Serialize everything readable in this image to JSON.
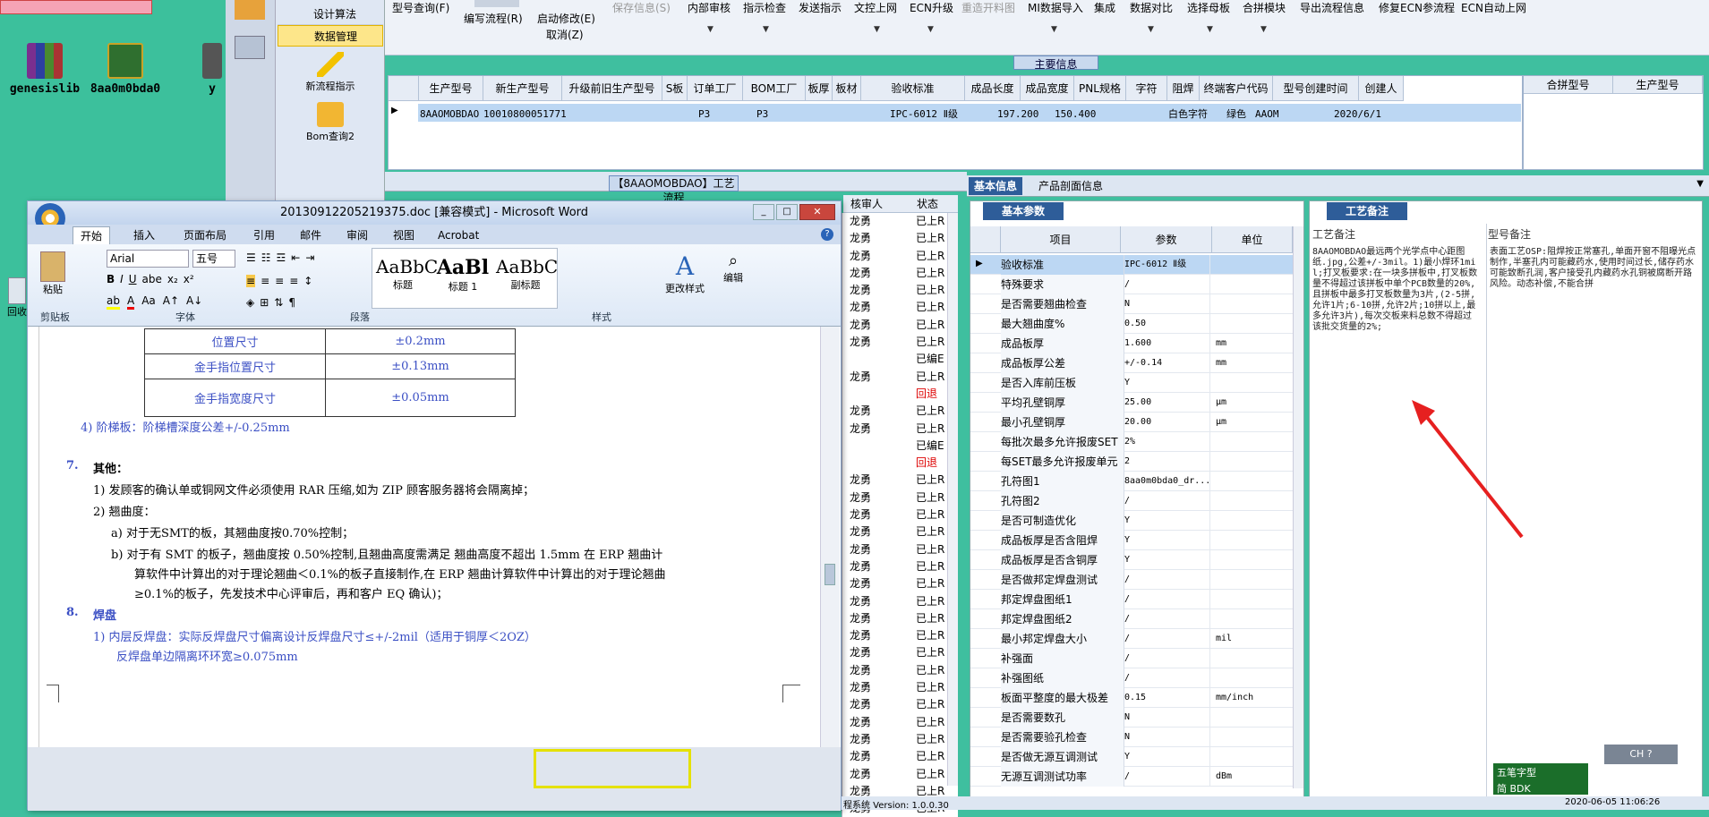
{
  "desktop": {
    "icons": [
      {
        "label": "genesislib"
      },
      {
        "label": "8aa0m0bda0"
      },
      {
        "label": "y"
      }
    ],
    "recycle": "回收"
  },
  "leftpanel": {
    "items": [
      "设计算法",
      "数据管理"
    ],
    "big": [
      "新流程指示",
      "Bom查询2"
    ]
  },
  "toolbar": {
    "buttons": [
      "型号查询(F)",
      "编写流程(R)",
      "启动修改(E)",
      "保存信息(S)",
      "内部审核",
      "指示检查",
      "发送指示",
      "文控上网",
      "ECN升级",
      "重造开料图",
      "MI数据导入",
      "集成",
      "数据对比",
      "选择母板",
      "合拼模块",
      "导出流程信息",
      "修复ECN参流程",
      "ECN自动上网"
    ],
    "cancel": "取消(Z)",
    "main_info": "主要信息"
  },
  "topgrid": {
    "headers": [
      "生产型号",
      "新生产型号",
      "升级前旧生产型号",
      "S板",
      "订单工厂",
      "BOM工厂",
      "板厚",
      "板材",
      "验收标准",
      "成品长度",
      "成品宽度",
      "PNL规格",
      "字符",
      "阻焊",
      "终端客户代码",
      "型号创建时间",
      "创建人"
    ],
    "row": [
      "8AAOMOBDAO",
      "10010800051771",
      "",
      "",
      "P3",
      "P3",
      "",
      "",
      "IPC-6012 Ⅱ级",
      "197.200",
      "150.400",
      "",
      "白色字符",
      "绿色",
      "AAOM",
      "2020/6/1",
      ""
    ],
    "right_headers": [
      "合拼型号",
      "生产型号"
    ]
  },
  "flow": {
    "title": "【8AAOMOBDAO】工艺流程",
    "review_header": "核审人",
    "status_header": "状态"
  },
  "review_rows": [
    [
      "龙勇",
      "已上R"
    ],
    [
      "龙勇",
      "已上R"
    ],
    [
      "龙勇",
      "已上R"
    ],
    [
      "龙勇",
      "已上R"
    ],
    [
      "龙勇",
      "已上R"
    ],
    [
      "龙勇",
      "已上R"
    ],
    [
      "龙勇",
      "已上R"
    ],
    [
      "龙勇",
      "已上R"
    ],
    [
      "",
      "已编E"
    ],
    [
      "龙勇",
      "已上R"
    ],
    [
      "",
      "回退"
    ],
    [
      "龙勇",
      "已上R"
    ],
    [
      "龙勇",
      "已上R"
    ],
    [
      "",
      "已编E"
    ],
    [
      "",
      "回退"
    ],
    [
      "龙勇",
      "已上R"
    ],
    [
      "龙勇",
      "已上R"
    ],
    [
      "龙勇",
      "已上R"
    ],
    [
      "龙勇",
      "已上R"
    ],
    [
      "龙勇",
      "已上R"
    ],
    [
      "龙勇",
      "已上R"
    ],
    [
      "龙勇",
      "已上R"
    ],
    [
      "龙勇",
      "已上R"
    ],
    [
      "龙勇",
      "已上R"
    ],
    [
      "龙勇",
      "已上R"
    ],
    [
      "龙勇",
      "已上R"
    ],
    [
      "龙勇",
      "已上R"
    ],
    [
      "龙勇",
      "已上R"
    ],
    [
      "龙勇",
      "已上R"
    ],
    [
      "龙勇",
      "已上R"
    ],
    [
      "龙勇",
      "已上R"
    ],
    [
      "龙勇",
      "已上R"
    ],
    [
      "龙勇",
      "已上R"
    ],
    [
      "龙勇",
      "已上R"
    ],
    [
      "龙勇",
      "已上R"
    ]
  ],
  "rightpanel": {
    "tabs": [
      "基本信息",
      "产品剖面信息"
    ],
    "basic_tab": "基本参数",
    "craft_tab": "工艺备注",
    "headers": [
      "项目",
      "参数",
      "单位"
    ],
    "rows": [
      [
        "验收标准",
        "IPC-6012 Ⅱ级",
        ""
      ],
      [
        "特殊要求",
        "/",
        ""
      ],
      [
        "是否需要翘曲检查",
        "N",
        ""
      ],
      [
        "最大翘曲度%",
        "0.50",
        ""
      ],
      [
        "成品板厚",
        "1.600",
        "mm"
      ],
      [
        "成品板厚公差",
        "+/-0.14",
        "mm"
      ],
      [
        "是否入库前压板",
        "Y",
        ""
      ],
      [
        "平均孔壁铜厚",
        "25.00",
        "μm"
      ],
      [
        "最小孔壁铜厚",
        "20.00",
        "μm"
      ],
      [
        "每批次最多允许报废SET",
        "2%",
        ""
      ],
      [
        "每SET最多允许报废单元",
        "2",
        ""
      ],
      [
        "孔符图1",
        "8aa0m0bda0_dr...",
        ""
      ],
      [
        "孔符图2",
        "/",
        ""
      ],
      [
        "是否可制造优化",
        "Y",
        ""
      ],
      [
        "成品板厚是否含阻焊",
        "Y",
        ""
      ],
      [
        "成品板厚是否含铜厚",
        "Y",
        ""
      ],
      [
        "是否做邦定焊盘测试",
        "/",
        ""
      ],
      [
        "邦定焊盘图纸1",
        "/",
        ""
      ],
      [
        "邦定焊盘图纸2",
        "/",
        ""
      ],
      [
        "最小邦定焊盘大小",
        "/",
        "mil"
      ],
      [
        "补强面",
        "/",
        ""
      ],
      [
        "补强图纸",
        "/",
        ""
      ],
      [
        "板面平整度的最大极差",
        "0.15",
        "mm/inch"
      ],
      [
        "是否需要数孔",
        "N",
        ""
      ],
      [
        "是否需要验孔检查",
        "N",
        ""
      ],
      [
        "是否做无源互调测试",
        "Y",
        ""
      ],
      [
        "无源互调测试功率",
        "/",
        "dBm"
      ]
    ],
    "craft_h1": "工艺备注",
    "craft_h2": "型号备注",
    "craft_text1": "8AAOMOBDAO最远两个光学点中心距图纸.jpg,公差+/-3mil。1)最小焊环1mil;打叉板要求:在一块多拼板中,打叉板数量不得超过该拼板中单个PCB数量的20%,且拼板中最多打叉板数量为3片,(2-5拼,允许1片;6-10拼,允许2片;10拼以上,最多允许3片),每次交板来料总数不得超过该批交货量的2%;",
    "craft_text2": "表面工艺OSP:阻焊按正常塞孔,单面开窗不阻曝光点制作,半塞孔内可能藏药水,使用时间过长,储存药水可能致断孔润,客户接受孔内藏药水孔铜被腐断开路风险。动态补偿,不能合拼"
  },
  "word": {
    "title": "20130912205219375.doc [兼容模式] - Microsoft Word",
    "tabs": [
      "开始",
      "插入",
      "页面布局",
      "引用",
      "邮件",
      "审阅",
      "视图",
      "Acrobat"
    ],
    "font": "Arial",
    "size": "五号",
    "groups": [
      "剪贴板",
      "字体",
      "段落",
      "样式",
      "编辑"
    ],
    "paste": "粘贴",
    "styles": [
      {
        "sample": "AaBbC",
        "name": "标题"
      },
      {
        "sample": "AaBl",
        "name": "标题 1"
      },
      {
        "sample": "AaBbC",
        "name": "副标题"
      }
    ],
    "change_style": "更改样式",
    "edit": "编辑",
    "table": [
      [
        "位置尺寸",
        "±0.2mm"
      ],
      [
        "金手指位置尺寸",
        "±0.13mm"
      ],
      [
        "金手指宽度尺寸",
        "±0.05mm"
      ]
    ],
    "lines": {
      "l4": "4) 阶梯板：阶梯槽深度公差+/-0.25mm",
      "h7num": "7.",
      "h7": "其他：",
      "p1": "1) 发顾客的确认单或铜网文件必须使用 RAR 压缩,如为 ZIP 顾客服务器将会隔离掉；",
      "p2": "2) 翘曲度：",
      "pa": "a)  对于无SMT的板，其翘曲度按0.70%控制；",
      "pb": "b)  对于有 SMT 的板子，翘曲度按 0.50%控制,且翘曲高度需满足  翘曲高度不超出 1.5mm 在 ERP 翘曲计",
      "pb2": "算软件中计算出的对于理论翘曲＜0.1%的板子直接制作,在 ERP 翘曲计算软件中计算出的对于理论翘曲",
      "pb3": "≥0.1%的板子，先发技术中心评审后，再和客户 EQ 确认)；",
      "h8num": "8.",
      "h8": "焊盘",
      "q1": "1) 内层反焊盘：实际反焊盘尺寸偏离设计反焊盘尺寸≤+/-2mil（适用于铜厚＜2OZ）",
      "q2": "反焊盘单边隔离环环宽≥0.075mm"
    }
  },
  "status": {
    "version": "程系统 Version: 1.0.0.30",
    "time": "2020-06-05 11:06:26"
  },
  "ime": {
    "ch": "CH",
    "name": "五笔字型",
    "mode": "简 BDK"
  }
}
